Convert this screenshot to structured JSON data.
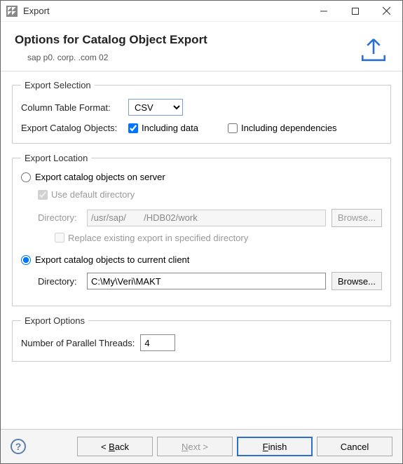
{
  "titlebar": {
    "title": "Export"
  },
  "header": {
    "title": "Options for Catalog Object Export",
    "subtitle": "sap     p0.         corp.        .com 02"
  },
  "exportSelection": {
    "legend": "Export Selection",
    "columnTableFormatLabel": "Column Table Format:",
    "columnTableFormatValue": "CSV",
    "exportCatalogObjectsLabel": "Export Catalog Objects:",
    "includingDataLabel": "Including data",
    "includingDataChecked": true,
    "includingDependenciesLabel": "Including dependencies",
    "includingDependenciesChecked": false
  },
  "exportLocation": {
    "legend": "Export Location",
    "onServerLabel": "Export catalog objects on server",
    "onServerSelected": false,
    "useDefaultDirLabel": "Use default directory",
    "useDefaultDirChecked": true,
    "serverDirLabel": "Directory:",
    "serverDirValue": "/usr/sap/       /HDB02/work",
    "replaceExistingLabel": "Replace existing export in specified directory",
    "replaceExistingChecked": false,
    "toClientLabel": "Export catalog objects to current client",
    "toClientSelected": true,
    "clientDirLabel": "Directory:",
    "clientDirValue": "C:\\My\\Veri\\MAKT",
    "browseLabel": "Browse..."
  },
  "exportOptions": {
    "legend": "Export Options",
    "parallelThreadsLabel": "Number of Parallel Threads:",
    "parallelThreadsValue": "4"
  },
  "buttons": {
    "back": "< Back",
    "next": "Next >",
    "finish": "Finish",
    "cancel": "Cancel"
  }
}
